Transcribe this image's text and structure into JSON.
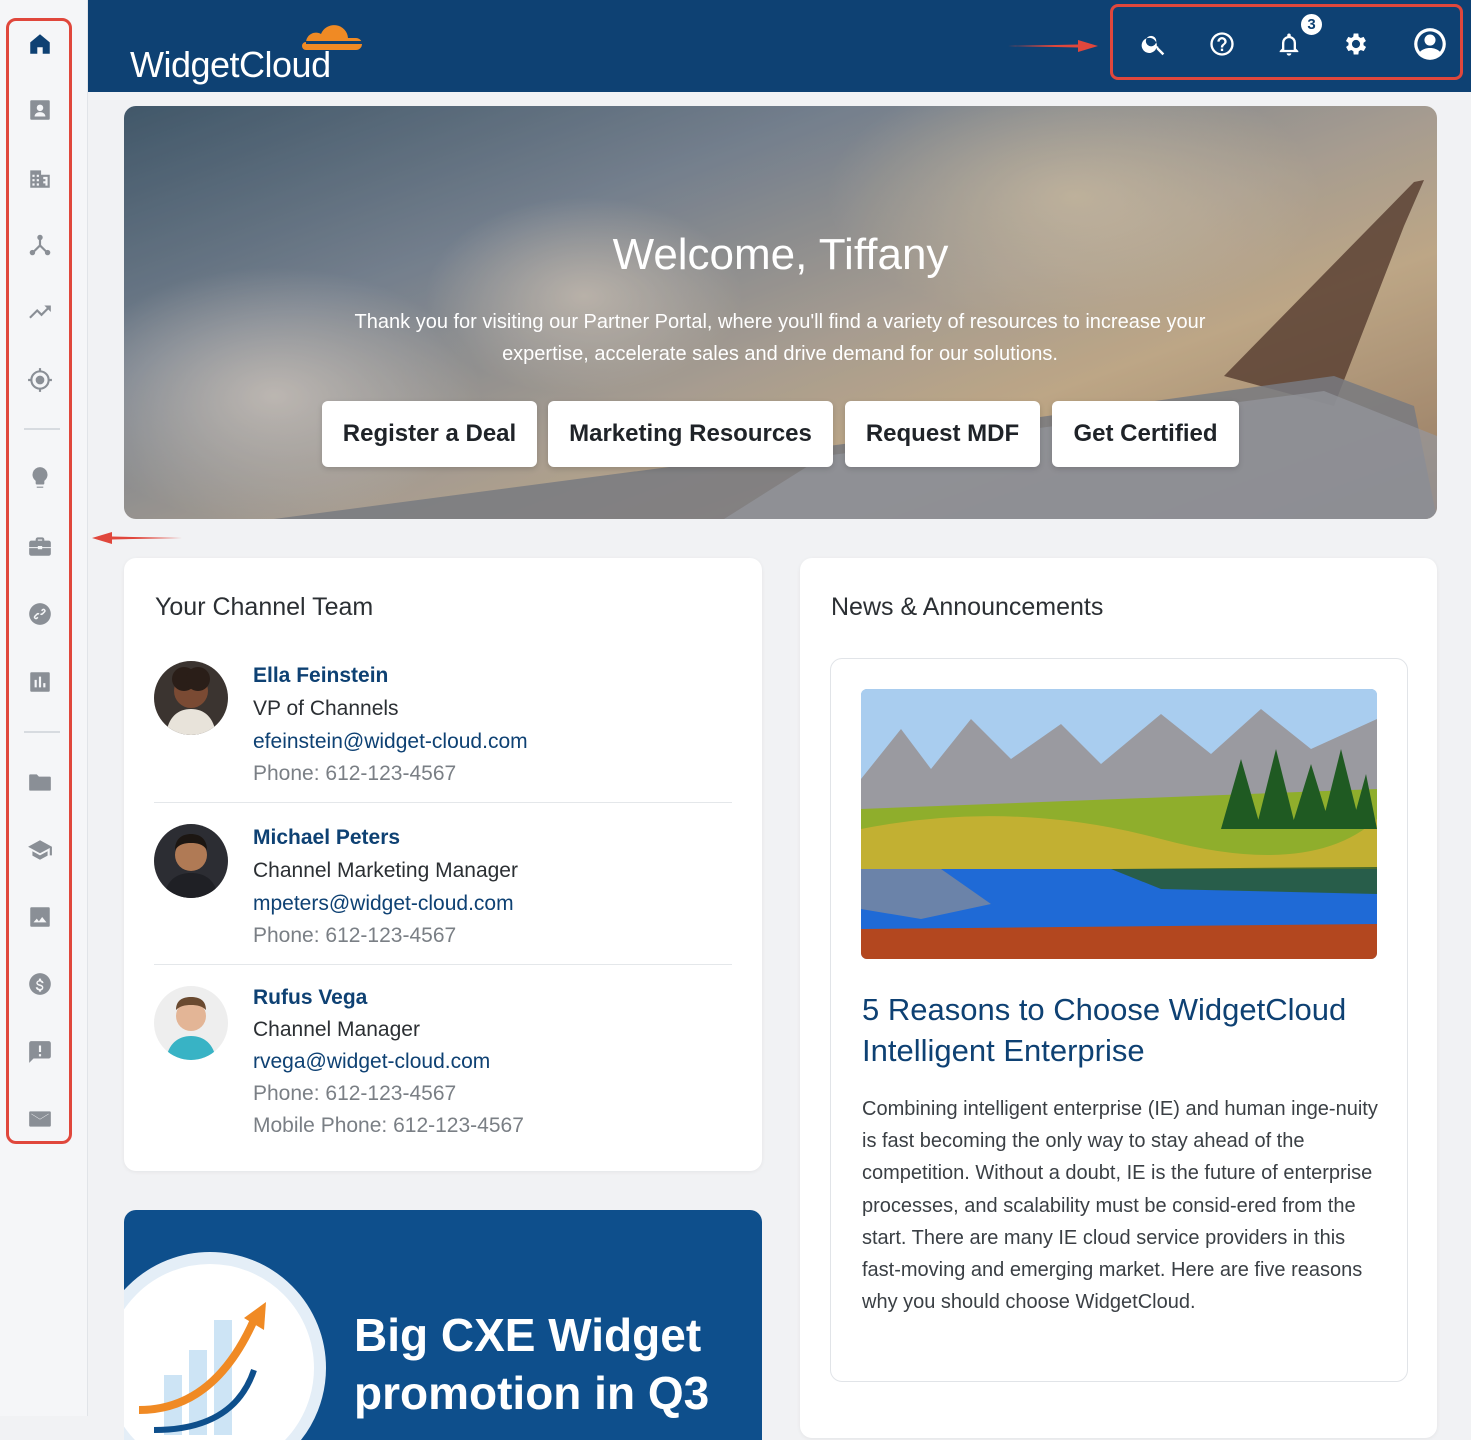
{
  "app": {
    "brand": "WidgetCloud"
  },
  "sidebar": {
    "items": [
      {
        "icon": "home-icon"
      },
      {
        "icon": "contact-card-icon"
      },
      {
        "icon": "building-icon"
      },
      {
        "icon": "hierarchy-icon"
      },
      {
        "icon": "trending-up-icon"
      },
      {
        "icon": "target-icon"
      },
      {
        "icon": "lightbulb-icon"
      },
      {
        "icon": "briefcase-icon"
      },
      {
        "icon": "link-icon"
      },
      {
        "icon": "bar-chart-icon"
      },
      {
        "icon": "folder-icon"
      },
      {
        "icon": "graduation-cap-icon"
      },
      {
        "icon": "image-icon"
      },
      {
        "icon": "dollar-icon"
      },
      {
        "icon": "feedback-icon"
      },
      {
        "icon": "mail-icon"
      }
    ]
  },
  "header": {
    "icons": [
      "search-icon",
      "help-icon",
      "bell-icon",
      "gear-icon",
      "account-icon"
    ],
    "notification_count": "3"
  },
  "hero": {
    "title": "Welcome, Tiffany",
    "subtitle": "Thank you for visiting our Partner Portal, where you'll find a variety of resources to increase your expertise, accelerate sales and drive demand for our solutions.",
    "buttons": [
      "Register a Deal",
      "Marketing Resources",
      "Request MDF",
      "Get Certified"
    ]
  },
  "team": {
    "title": "Your Channel Team",
    "members": [
      {
        "name": "Ella Feinstein",
        "role": "VP of Channels",
        "email": "efeinstein@widget-cloud.com",
        "phone": "Phone: 612-123-4567"
      },
      {
        "name": "Michael Peters",
        "role": "Channel Marketing Manager",
        "email": "mpeters@widget-cloud.com",
        "phone": "Phone: 612-123-4567"
      },
      {
        "name": "Rufus Vega",
        "role": "Channel Manager",
        "email": "rvega@widget-cloud.com",
        "phone": "Phone: 612-123-4567",
        "mobile": "Mobile Phone: 612-123-4567"
      }
    ]
  },
  "news": {
    "title": "News & Announcements",
    "article": {
      "headline": "5 Reasons to Choose WidgetCloud Intelligent Enterprise",
      "body": "Combining intelligent enterprise (IE) and human inge-nuity is fast becoming the only way to stay ahead of the competition. Without a doubt, IE is the future of enterprise processes, and scalability must be consid-ered from the start. There are many IE cloud service providers in this fast-moving and emerging market. Here are five reasons why you should choose WidgetCloud."
    }
  },
  "promo": {
    "text": "Big CXE Widget promotion in Q3"
  },
  "colors": {
    "primary": "#0e4173",
    "highlight": "#e0473c",
    "background": "#f1f2f4"
  }
}
